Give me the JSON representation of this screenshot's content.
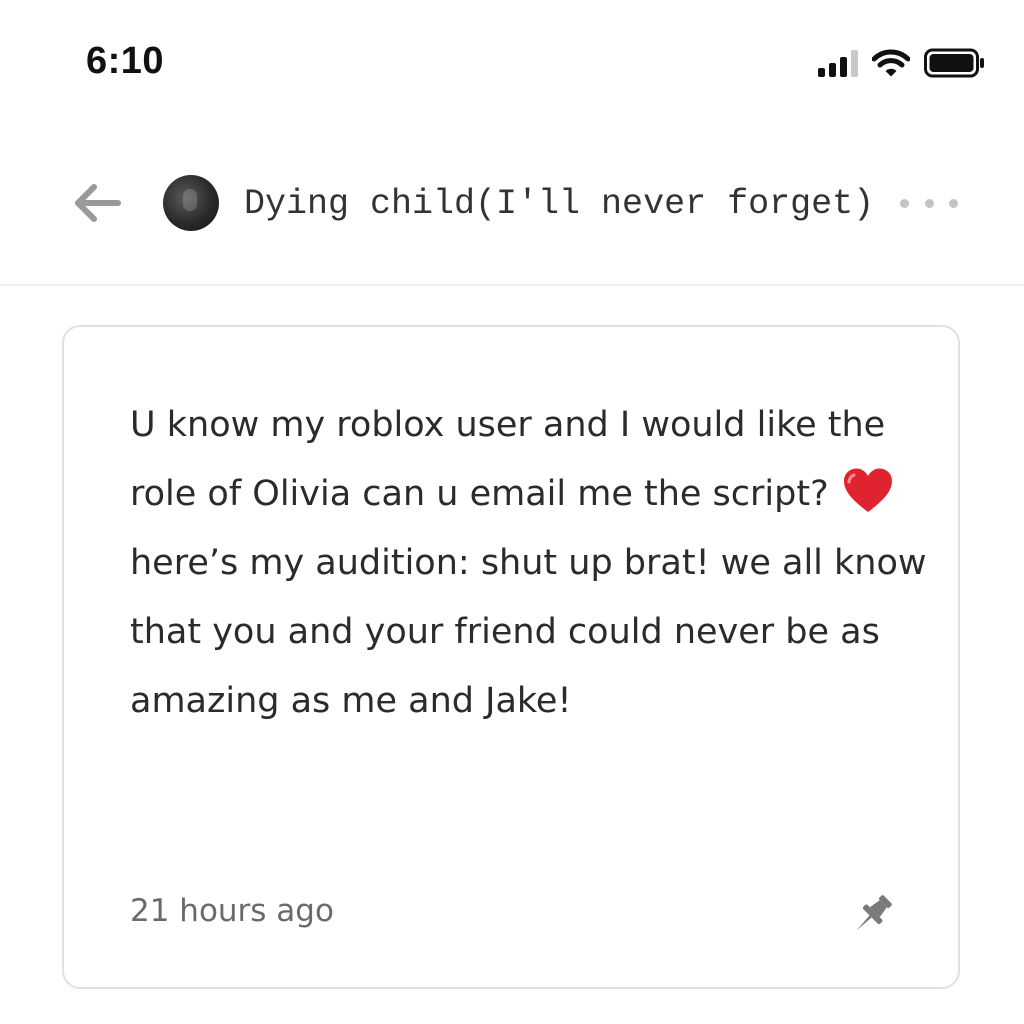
{
  "status_bar": {
    "time": "6:10",
    "icons": [
      "cellular-signal-icon",
      "wifi-icon",
      "battery-icon"
    ]
  },
  "header": {
    "back_icon": "arrow-left-icon",
    "avatar": "avatar",
    "title": "Dying child(I'll never forget)",
    "more_icon": "more-horizontal-icon"
  },
  "message": {
    "text_before_emoji": "U know my roblox user and I would like the role of Olivia can u email me the script?",
    "emoji": "red-heart-icon",
    "text_after_emoji": "here’s my audition: shut up brat! we all know that you and your friend could never be as amazing as me and Jake!",
    "timestamp": "21 hours ago",
    "pin_icon": "pin-icon"
  },
  "colors": {
    "background": "#ffffff",
    "text": "#2b2b2b",
    "muted_text": "#6a6a6a",
    "card_border": "#e0e0e0",
    "icon_gray": "#9a9a9a",
    "heart": "#e0242f"
  }
}
